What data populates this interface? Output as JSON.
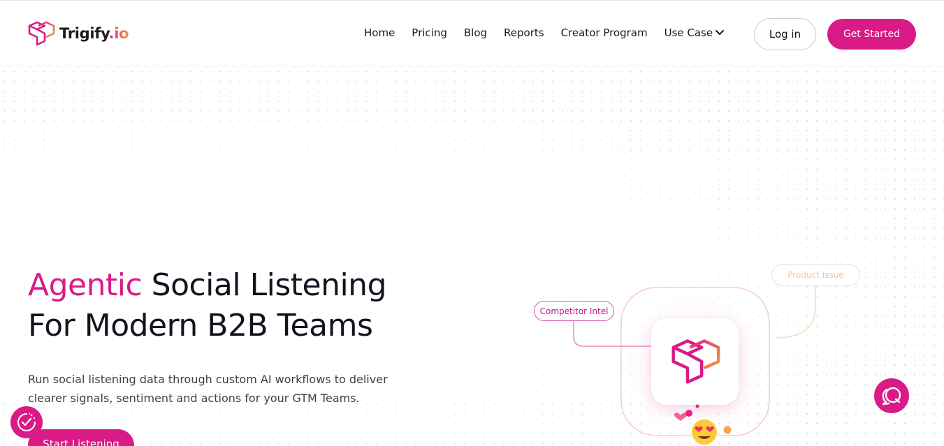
{
  "brand": {
    "name_main": "Trigify",
    "name_suffix": ".io",
    "accent_color": "#d91a87"
  },
  "nav": {
    "items": [
      {
        "label": "Home"
      },
      {
        "label": "Pricing"
      },
      {
        "label": "Blog"
      },
      {
        "label": "Reports"
      },
      {
        "label": "Creator Program"
      }
    ],
    "use_case_label": "Use Case",
    "login_label": "Log in",
    "get_started_label": "Get Started"
  },
  "hero": {
    "headline_accent": "Agentic",
    "headline_rest_line1": " Social Listening",
    "headline_line2": "For Modern B2B Teams",
    "subtext_line1": "Run social listening data through custom AI workflows to deliver",
    "subtext_line2": "clearer signals, sentiment and actions for your GTM Teams.",
    "cta_label": "Start Listening"
  },
  "illustration": {
    "tag_competitor": "Competitor Intel",
    "tag_product": "Product Issue",
    "icons": [
      "trigify-logo-icon",
      "heart-icon",
      "heart-eyes-emoji-icon"
    ]
  },
  "floating": {
    "consent_icon": "cookie-consent-icon",
    "chat_icon": "chat-bubble-icon"
  }
}
